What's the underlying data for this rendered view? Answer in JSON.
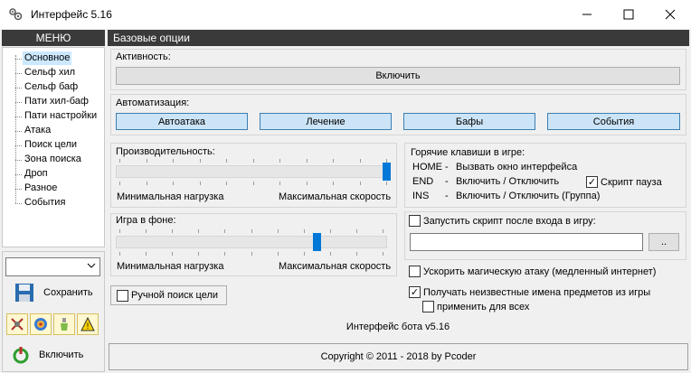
{
  "window": {
    "title": "Интерфейс 5.16",
    "minimize_icon": "minimize-icon",
    "maximize_icon": "maximize-icon",
    "close_icon": "close-icon"
  },
  "left": {
    "menu_header": "МЕНЮ",
    "items": [
      "Основное",
      "Сельф хил",
      "Сельф баф",
      "Пати хил-баф",
      "Пати настройки",
      "Атака",
      "Поиск цели",
      "Зона поиска",
      "Дроп",
      "Разное",
      "События"
    ],
    "selected_index": 0,
    "combo_value": "",
    "save_label": "Сохранить",
    "enable_label": "Включить",
    "tool_icons": [
      "settings-x-icon",
      "globe-icon",
      "potion-icon",
      "warning-icon"
    ]
  },
  "main": {
    "header": "Базовые опции",
    "activity": {
      "title": "Активность:",
      "button": "Включить"
    },
    "automation": {
      "title": "Автоматизация:",
      "buttons": [
        "Автоатака",
        "Лечение",
        "Бафы",
        "События"
      ]
    },
    "performance": {
      "title": "Производительность:",
      "min_label": "Минимальная нагрузка",
      "max_label": "Максимальная скорость",
      "level": 1.0
    },
    "background": {
      "title": "Игра в фоне:",
      "min_label": "Минимальная нагрузка",
      "max_label": "Максимальная скорость",
      "level": 0.75
    },
    "hotkeys": {
      "title": "Горячие клавиши в игре:",
      "rows": [
        {
          "key": "HOME",
          "sep": "-",
          "action": "Вызвать окно интерфейса"
        },
        {
          "key": "END",
          "sep": "-",
          "action": "Включить / Отключить"
        },
        {
          "key": "INS",
          "sep": "-",
          "action": "Включить / Отключить (Группа)"
        }
      ],
      "pause_label": "Скрипт пауза",
      "pause_checked": true
    },
    "autostart": {
      "label": "Запустить скрипт после входа в игру:",
      "checked": false,
      "path": "",
      "browse": ".."
    },
    "manual_search": {
      "label": "Ручной поиск цели",
      "checked": false
    },
    "speed_magic": {
      "label": "Ускорить магическую атаку (медленный интернет)",
      "checked": false
    },
    "unknown_names": {
      "label": "Получать неизвестные имена предметов из игры",
      "checked": true
    },
    "apply_all": {
      "label": "применить для всех",
      "checked": false
    },
    "version": "Интерфейс бота v5.16",
    "copyright": "Copyright © 2011 - 2018 by Pcoder"
  }
}
